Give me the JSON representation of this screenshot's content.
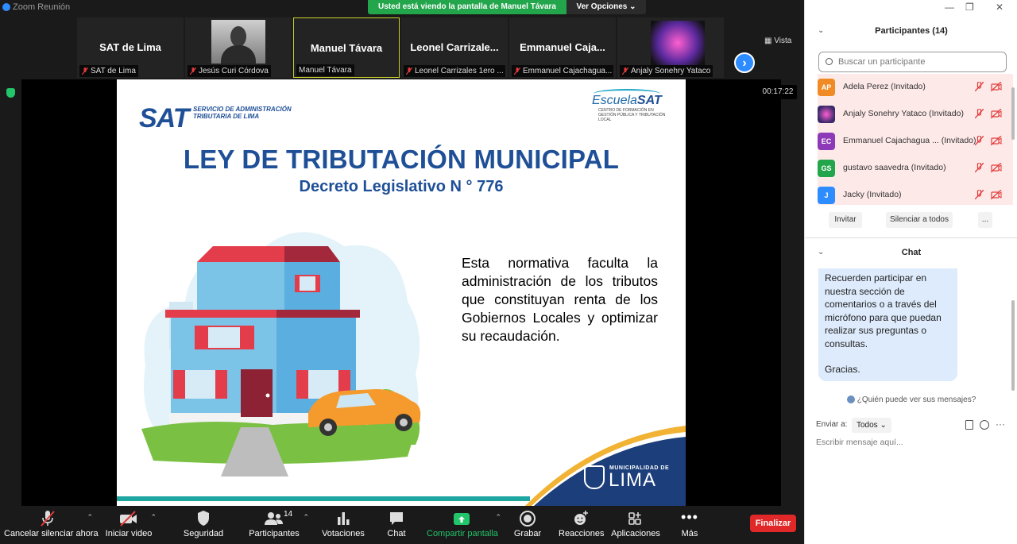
{
  "window": {
    "title": "Zoom Reunión"
  },
  "banner": {
    "text": "Usted está viendo la pantalla de Manuel Távara",
    "options": "Ver Opciones ⌄"
  },
  "strip": {
    "vista": "Vista",
    "thumbs": [
      {
        "name": "SAT de Lima",
        "label": "SAT de Lima"
      },
      {
        "name": "",
        "label": "Jesús Curi Córdova"
      },
      {
        "name": "Manuel Távara",
        "label": "Manuel Távara"
      },
      {
        "name": "Leonel  Carrizale...",
        "label": "Leonel Carrizales 1ero ..."
      },
      {
        "name": "Emmanuel  Caja...",
        "label": "Emmanuel Cajachagua..."
      },
      {
        "name": "",
        "label": "Anjaly Sonehry Yataco"
      }
    ]
  },
  "stage": {
    "timer": "00:17:22"
  },
  "slide": {
    "sat_big": "SAT",
    "sat_small": "SERVICIO DE ADMINISTRACIÓN TRIBUTARIA DE LIMA",
    "escuela_a": "Escuela",
    "escuela_b": "SAT",
    "escuela_sub": "CENTRO DE FORMACIÓN EN GESTIÓN PÚBLICA Y TRIBUTACIÓN LOCAL",
    "title": "LEY DE TRIBUTACIÓN MUNICIPAL",
    "subtitle": "Decreto Legislativo N ° 776",
    "body": "Esta normativa faculta la administración de los tributos que constituyan renta de los Gobiernos Locales y optimizar su recaudación.",
    "muni_top": "MUNICIPALIDAD DE",
    "muni_big": "LIMA"
  },
  "toolbar": {
    "mute": "Cancelar silenciar ahora",
    "video": "Iniciar video",
    "security": "Seguridad",
    "participants": "Participantes",
    "participants_count": "14",
    "polls": "Votaciones",
    "chat": "Chat",
    "share": "Compartir pantalla",
    "record": "Grabar",
    "reactions": "Reacciones",
    "apps": "Aplicaciones",
    "more": "Más",
    "end": "Finalizar"
  },
  "participants": {
    "header": "Participantes (14)",
    "search_placeholder": "Buscar un participante",
    "list": [
      {
        "initials": "AP",
        "name": "Adela Perez (Invitado)",
        "color": "#f08a24"
      },
      {
        "initials": "",
        "name": "Anjaly Sonehry Yataco (Invitado)",
        "color": "#3b2a6b"
      },
      {
        "initials": "EC",
        "name": "Emmanuel Cajachagua ... (Invitado)",
        "color": "#8e3ab8"
      },
      {
        "initials": "GS",
        "name": "gustavo saavedra (Invitado)",
        "color": "#23a54b"
      },
      {
        "initials": "J",
        "name": "Jacky (Invitado)",
        "color": "#2d8cff"
      }
    ],
    "invite": "Invitar",
    "mute_all": "Silenciar a todos",
    "more": "..."
  },
  "chat": {
    "header": "Chat",
    "message_l1": "Recuerden participar en nuestra sección de comentarios o a través del micrófono para que puedan realizar sus preguntas o consultas.",
    "message_l2": "Gracias.",
    "who_sees": "¿Quién puede ver sus mensajes?",
    "send_to": "Enviar a:",
    "to_value": "Todos ⌄",
    "input_placeholder": "Escribir mensaje aquí..."
  },
  "colors": {
    "zoom_blue": "#2d8cff",
    "banner_green": "#23a54b",
    "end_red": "#e02828",
    "sat_blue": "#1e4f97"
  }
}
